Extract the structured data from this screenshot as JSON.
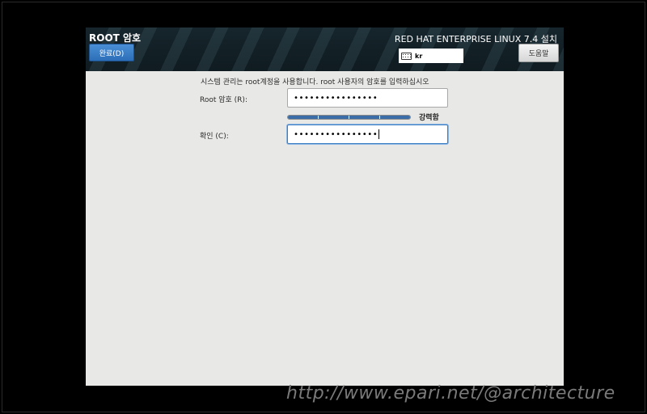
{
  "header": {
    "title": "ROOT 암호",
    "done_label": "완료(D)",
    "product": "RED HAT ENTERPRISE LINUX 7.4 설치",
    "keyboard_layout": "kr",
    "help_label": "도움말"
  },
  "form": {
    "instruction": "시스템 관리는 root계정을 사용합니다. root 사용자의 암호를 입력하십시오",
    "root_label": "Root 암호 (R):",
    "root_value": "••••••••••••••••",
    "strength_label": "강력함",
    "strength_fraction": 1.0,
    "confirm_label": "확인 (C):",
    "confirm_value": "••••••••••••••••"
  },
  "watermark": "http://www.epari.net/@architecture",
  "colors": {
    "accent": "#3e7fc4",
    "header_bg": "#12212a",
    "strength": "#3b6ea8"
  }
}
